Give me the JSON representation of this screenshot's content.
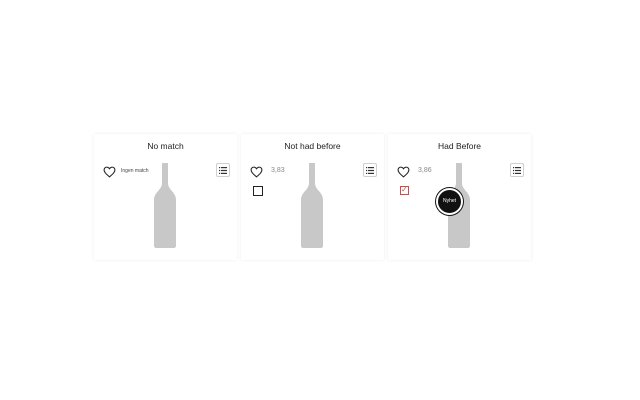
{
  "panels": [
    {
      "title": "No match",
      "match_text": "Ingen match"
    },
    {
      "title": "Not had before",
      "rating": "3,83"
    },
    {
      "title": "Had Before",
      "rating": "3,86",
      "badge": "Nyhet"
    }
  ],
  "icons": {
    "heart": "heart-icon",
    "list": "list-icon",
    "bottle": "wine-bottle-icon",
    "check": "check-icon"
  },
  "colors": {
    "bottle": "#c8c8c8",
    "check_accent": "#d44444",
    "badge_bg": "#111111"
  }
}
